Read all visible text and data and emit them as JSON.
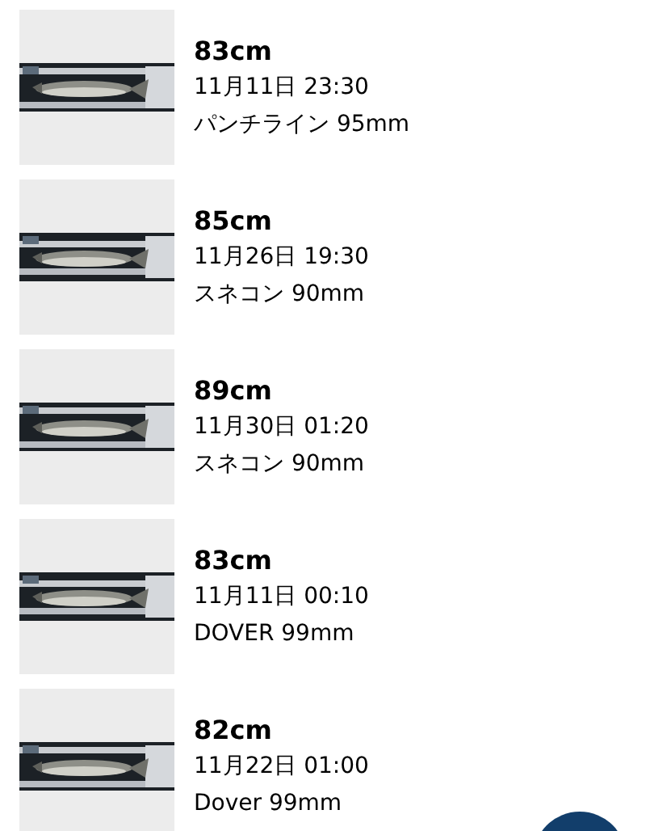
{
  "catches": [
    {
      "size": "83cm",
      "datetime": "11月11日 23:30",
      "lure": "パンチライン 95mm"
    },
    {
      "size": "85cm",
      "datetime": "11月26日 19:30",
      "lure": "スネコン 90mm"
    },
    {
      "size": "89cm",
      "datetime": "11月30日 01:20",
      "lure": "スネコン 90mm"
    },
    {
      "size": "83cm",
      "datetime": "11月11日 00:10",
      "lure": "DOVER 99mm"
    },
    {
      "size": "82cm",
      "datetime": "11月22日 01:00",
      "lure": "Dover 99mm"
    }
  ]
}
